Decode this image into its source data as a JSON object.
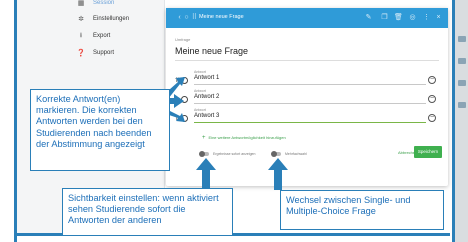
{
  "sidebar": {
    "items": [
      {
        "label": "Session",
        "icon": "session-icon"
      },
      {
        "label": "Einstellungen",
        "icon": "gear-icon"
      },
      {
        "label": "Export",
        "icon": "export-icon"
      },
      {
        "label": "Support",
        "icon": "help-icon"
      }
    ]
  },
  "dialog": {
    "title": "Meine neue Frage",
    "subtitle": "Umfrage",
    "question": "Meine neue Frage",
    "answer_label": "Antwort",
    "answers": [
      "Antwort 1",
      "Antwort 2",
      "Antwort 3"
    ],
    "add_option": "Eine weitere Antwortmöglichkeit hinzufügen",
    "toggle_results": "Ergebnisse sofort anzeigen",
    "toggle_multiple": "Mehrfachwahl",
    "cancel": "Abbrechen",
    "save": "Speichern"
  },
  "callouts": {
    "left": "Korrekte Antwort(en) markieren. Die korrekten Antworten werden bei den Studierenden nach beenden der Abstimmung angezeigt",
    "bottom_left": "Sichtbarkeit einstellen: wenn aktiviert sehen Studierende sofort die Antworten der anderen",
    "bottom_right": "Wechsel zwischen Single- und Multiple-Choice Frage"
  },
  "colors": {
    "header_blue": "#2f9bd8",
    "callout_blue": "#2a7fb8",
    "accent_green": "#3fb04f"
  }
}
